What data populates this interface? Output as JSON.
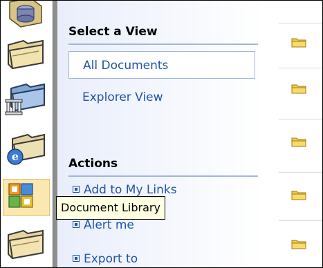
{
  "nav": {
    "select_view_header": "Select a View",
    "views": [
      {
        "label": "All Documents",
        "selected": true
      },
      {
        "label": "Explorer View",
        "selected": false
      }
    ],
    "actions_header": "Actions",
    "actions": [
      {
        "label": "Add to My Links"
      },
      {
        "label": "Alert me"
      },
      {
        "label": "Export to"
      }
    ]
  },
  "icons": [
    "database-icon",
    "folder-icon",
    "library-folder-icon",
    "web-folder-icon",
    "document-library-icon",
    "folder-icon"
  ],
  "tooltip": {
    "text": "Document Library"
  },
  "colors": {
    "link": "#2054a8",
    "rule": "#9eb6dd",
    "tooltip_bg": "#ffffe1",
    "selected_icon_bg": "#fbe7b0"
  }
}
